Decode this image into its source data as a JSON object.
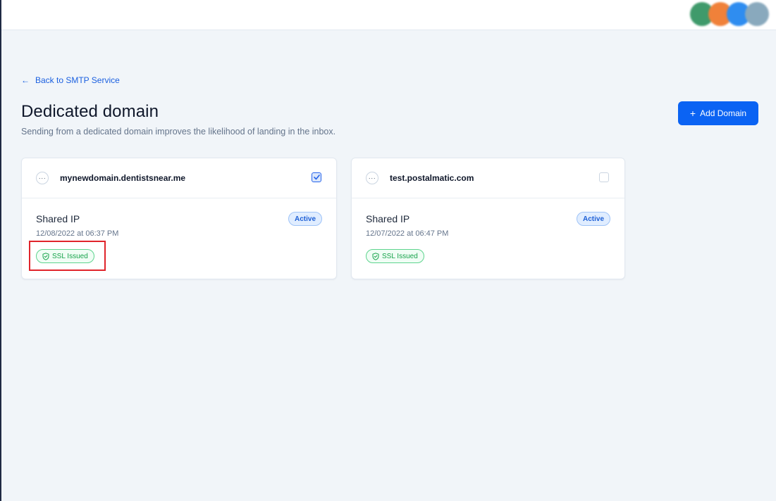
{
  "header": {
    "avatars": [
      {
        "color": "#3f9a6b"
      },
      {
        "color": "#f0813a"
      },
      {
        "color": "#2f8df0"
      },
      {
        "color": "#89a9bd"
      }
    ]
  },
  "back_link": {
    "label": "Back to SMTP Service"
  },
  "page": {
    "title": "Dedicated domain",
    "subtitle": "Sending from a dedicated domain improves the likelihood of landing in the inbox.",
    "add_button_label": "Add Domain"
  },
  "domains": [
    {
      "name": "mynewdomain.dentistsnear.me",
      "checked": true,
      "ip_type": "Shared IP",
      "date": "12/08/2022 at 06:37 PM",
      "status": "Active",
      "ssl": "SSL Issued"
    },
    {
      "name": "test.postalmatic.com",
      "checked": false,
      "ip_type": "Shared IP",
      "date": "12/07/2022 at 06:47 PM",
      "status": "Active",
      "ssl": "SSL Issued"
    }
  ],
  "colors": {
    "accent": "#0b63f3",
    "success": "#16a34a",
    "highlight": "#e0242b"
  }
}
